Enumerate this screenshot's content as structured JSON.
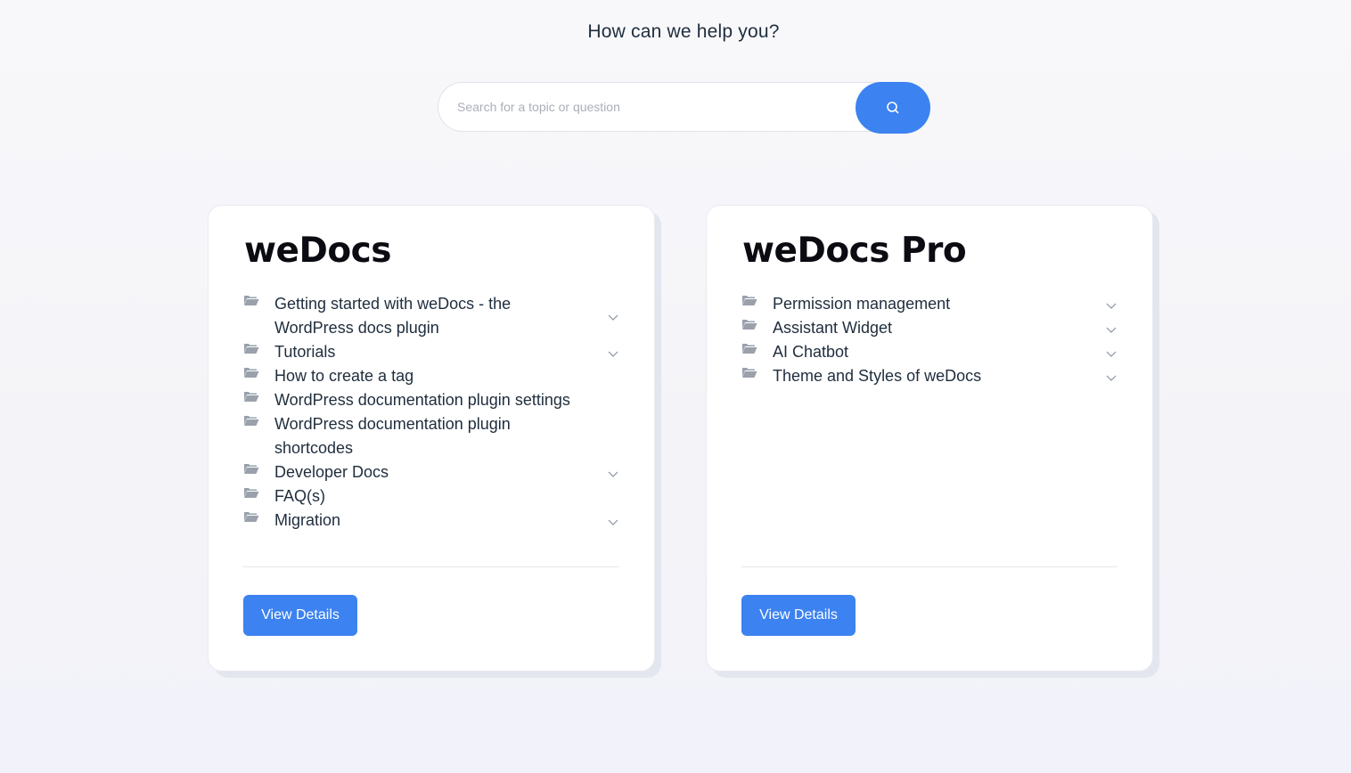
{
  "header": {
    "title": "How can we help you?"
  },
  "search": {
    "placeholder": "Search for a topic or question",
    "button_icon": "search-icon"
  },
  "colors": {
    "accent": "#3c82f0",
    "text": "#1f2d3d",
    "folder_icon": "#9aa1ab"
  },
  "cards": [
    {
      "title": "weDocs",
      "items": [
        {
          "label": "Getting started with weDocs - the WordPress docs plugin",
          "expandable": true
        },
        {
          "label": "Tutorials",
          "expandable": true
        },
        {
          "label": "How to create a tag",
          "expandable": false
        },
        {
          "label": "WordPress documentation plugin settings",
          "expandable": false
        },
        {
          "label": "WordPress documentation plugin shortcodes",
          "expandable": false
        },
        {
          "label": "Developer Docs",
          "expandable": true
        },
        {
          "label": "FAQ(s)",
          "expandable": false
        },
        {
          "label": "Migration",
          "expandable": true
        }
      ],
      "button_label": "View Details"
    },
    {
      "title": "weDocs Pro",
      "items": [
        {
          "label": "Permission management",
          "expandable": true
        },
        {
          "label": "Assistant Widget",
          "expandable": true
        },
        {
          "label": "AI Chatbot",
          "expandable": true
        },
        {
          "label": "Theme and Styles of weDocs",
          "expandable": true
        }
      ],
      "button_label": "View Details"
    }
  ]
}
